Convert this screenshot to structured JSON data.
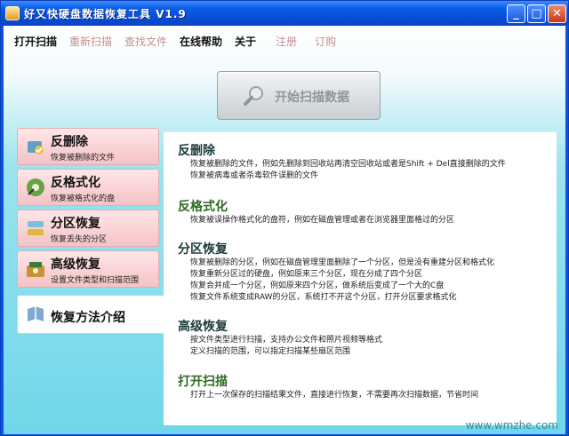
{
  "window": {
    "title": "好又快硬盘数据恢复工具  V1.9"
  },
  "menu": {
    "items": [
      {
        "label": "打开扫描",
        "enabled": true
      },
      {
        "label": "重新扫描",
        "enabled": false
      },
      {
        "label": "查找文件",
        "enabled": false
      },
      {
        "label": "在线帮助",
        "enabled": true
      },
      {
        "label": "关于",
        "enabled": true
      },
      {
        "label": "注册",
        "enabled": false
      },
      {
        "label": "订购",
        "enabled": false
      }
    ]
  },
  "scan_button": {
    "label": "开始扫描数据",
    "icon": "magnifier-icon"
  },
  "nav": [
    {
      "title": "反删除",
      "subtitle": "恢复被删除的文件",
      "icon": "undelete-icon"
    },
    {
      "title": "反格式化",
      "subtitle": "恢复被格式化的盘",
      "icon": "unformat-icon"
    },
    {
      "title": "分区恢复",
      "subtitle": "恢复丢失的分区",
      "icon": "partition-icon"
    },
    {
      "title": "高级恢复",
      "subtitle": "设置文件类型和扫描范围",
      "icon": "advanced-icon"
    },
    {
      "title": "恢复方法介绍",
      "subtitle": "",
      "icon": "book-icon",
      "active": true
    }
  ],
  "sections": [
    {
      "heading": "反删除",
      "lines": [
        "恢复被删除的文件，例如先删除到回收站再清空回收站或者是Shift + Del直接删除的文件",
        "恢复被病毒或者杀毒软件误删的文件"
      ]
    },
    {
      "heading": "反格式化",
      "lines": [
        "恢复被误操作格式化的盘符，例如在磁盘管理或者在浏览器里面格过的分区"
      ]
    },
    {
      "heading": "分区恢复",
      "lines": [
        "恢复被删除的分区，例如在磁盘管理里面删除了一个分区，但是没有重建分区和格式化",
        "恢复重新分区过的硬盘，例如原来三个分区，现在分成了四个分区",
        "恢复合并成一个分区，例如原来四个分区，做系统后变成了一个大的C盘",
        "恢复文件系统变成RAW的分区，系统打不开这个分区，打开分区要求格式化"
      ]
    },
    {
      "heading": "高级恢复",
      "lines": [
        "按文件类型进行扫描，支持办公文件和照片视频等格式",
        "定义扫描的范围，可以指定扫描某些扇区范围"
      ]
    },
    {
      "heading": "打开扫描",
      "lines": [
        "打开上一次保存的扫描结果文件，直接进行恢复，不需要再次扫描数据，节省时间"
      ]
    }
  ],
  "watermark": "www.wmzhe.com"
}
